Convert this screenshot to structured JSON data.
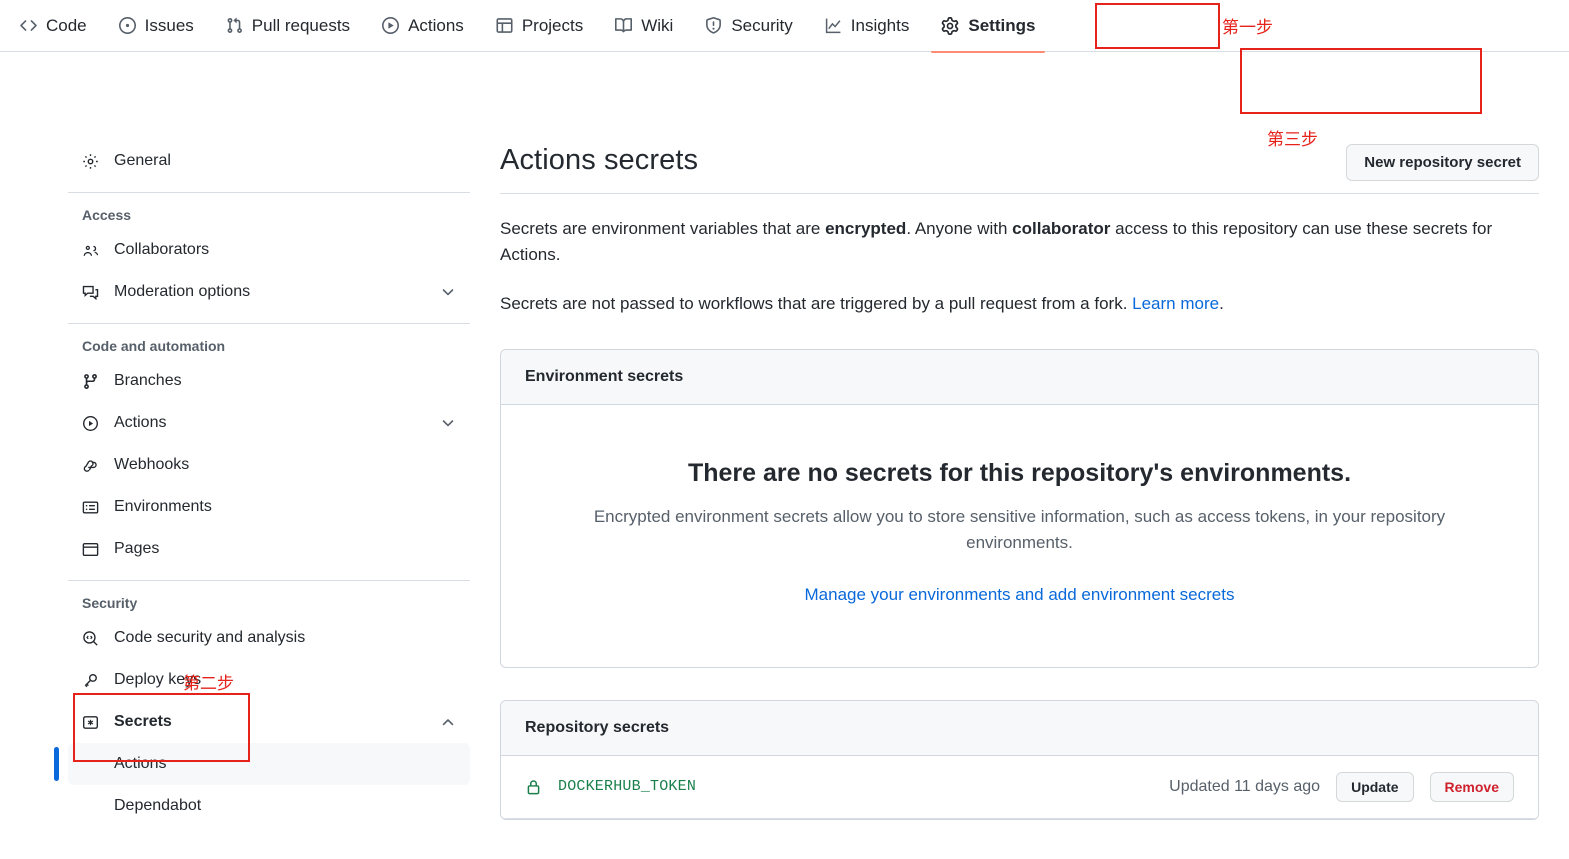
{
  "topnav": {
    "items": [
      {
        "label": "Code",
        "icon": "code-icon",
        "active": false
      },
      {
        "label": "Issues",
        "icon": "issue-opened-icon",
        "active": false
      },
      {
        "label": "Pull requests",
        "icon": "git-pull-request-icon",
        "active": false
      },
      {
        "label": "Actions",
        "icon": "play-icon",
        "active": false
      },
      {
        "label": "Projects",
        "icon": "table-icon",
        "active": false
      },
      {
        "label": "Wiki",
        "icon": "book-icon",
        "active": false
      },
      {
        "label": "Security",
        "icon": "shield-icon",
        "active": false
      },
      {
        "label": "Insights",
        "icon": "graph-icon",
        "active": false
      },
      {
        "label": "Settings",
        "icon": "gear-icon",
        "active": true
      }
    ]
  },
  "annotations": {
    "step1": "第一步",
    "step2": "第二步",
    "step3": "第三步",
    "color": "#e5231b"
  },
  "sidebar": {
    "general": {
      "label": "General",
      "icon": "gear-icon"
    },
    "groups": [
      {
        "title": "Access",
        "items": [
          {
            "label": "Collaborators",
            "icon": "people-icon",
            "chevron": ""
          },
          {
            "label": "Moderation options",
            "icon": "comment-discussion-icon",
            "chevron": "chevron-down-icon"
          }
        ]
      },
      {
        "title": "Code and automation",
        "items": [
          {
            "label": "Branches",
            "icon": "git-branch-icon",
            "chevron": ""
          },
          {
            "label": "Actions",
            "icon": "play-icon",
            "chevron": "chevron-down-icon"
          },
          {
            "label": "Webhooks",
            "icon": "webhook-icon",
            "chevron": ""
          },
          {
            "label": "Environments",
            "icon": "server-icon",
            "chevron": ""
          },
          {
            "label": "Pages",
            "icon": "browser-icon",
            "chevron": ""
          }
        ]
      },
      {
        "title": "Security",
        "items": [
          {
            "label": "Code security and analysis",
            "icon": "codescan-icon",
            "chevron": ""
          },
          {
            "label": "Deploy keys",
            "icon": "key-icon",
            "chevron": ""
          },
          {
            "label": "Secrets",
            "icon": "asterisk-key-icon",
            "chevron": "chevron-up-icon"
          }
        ]
      }
    ],
    "secrets_children": [
      {
        "label": "Actions",
        "selected": true
      },
      {
        "label": "Dependabot",
        "selected": false
      }
    ]
  },
  "main": {
    "title": "Actions secrets",
    "new_secret_button": "New repository secret",
    "paragraph1": {
      "part1": "Secrets are environment variables that are ",
      "bold1": "encrypted",
      "part2": ". Anyone with ",
      "bold2": "collaborator",
      "part3": " access to this repository can use these secrets for Actions."
    },
    "paragraph2": {
      "text": "Secrets are not passed to workflows that are triggered by a pull request from a fork. ",
      "link": "Learn more",
      "suffix": "."
    },
    "environment_card": {
      "header": "Environment secrets",
      "blank_title": "There are no secrets for this repository's environments.",
      "blank_desc": "Encrypted environment secrets allow you to store sensitive information, such as access tokens, in your repository environments.",
      "blank_link": "Manage your environments and add environment secrets"
    },
    "repository_card": {
      "header": "Repository secrets",
      "rows": [
        {
          "name": "DOCKERHUB_TOKEN",
          "updated": "Updated 11 days ago",
          "update_label": "Update",
          "remove_label": "Remove",
          "icon": "lock-icon",
          "color": "#1a7f4b"
        }
      ]
    }
  }
}
